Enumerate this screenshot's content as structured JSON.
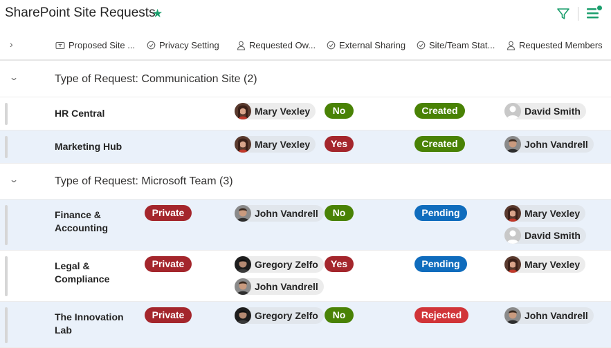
{
  "header": {
    "title": "SharePoint Site Requests"
  },
  "columns": [
    {
      "label": "Proposed Site ..."
    },
    {
      "label": "Privacy Setting"
    },
    {
      "label": "Requested Ow..."
    },
    {
      "label": "External Sharing"
    },
    {
      "label": "Site/Team Stat..."
    },
    {
      "label": "Requested Members"
    }
  ],
  "groups": [
    {
      "label": "Type of Request: Communication Site (2)"
    },
    {
      "label": "Type of Request: Microsoft Team (3)"
    }
  ],
  "rows": [
    {
      "title": "HR Central",
      "privacy": "",
      "owners": [
        "Mary Vexley"
      ],
      "external": "No",
      "status": "Created",
      "members": [
        "David Smith"
      ]
    },
    {
      "title": "Marketing Hub",
      "privacy": "",
      "owners": [
        "Mary Vexley"
      ],
      "external": "Yes",
      "status": "Created",
      "members": [
        "John Vandrell"
      ]
    },
    {
      "title": "Finance & Accounting",
      "privacy": "Private",
      "owners": [
        "John Vandrell"
      ],
      "external": "No",
      "status": "Pending",
      "members": [
        "Mary Vexley",
        "David Smith"
      ]
    },
    {
      "title": "Legal & Compliance",
      "privacy": "Private",
      "owners": [
        "Gregory Zelfo",
        "John Vandrell"
      ],
      "external": "Yes",
      "status": "Pending",
      "members": [
        "Mary Vexley"
      ]
    },
    {
      "title": "The Innovation Lab",
      "privacy": "Private",
      "owners": [
        "Gregory Zelfo"
      ],
      "external": "No",
      "status": "Rejected",
      "members": [
        "John Vandrell"
      ]
    }
  ],
  "colors": {
    "accent": "#1a9e6c",
    "pill_no": "#498205",
    "pill_yes": "#a4262c",
    "pill_pending": "#0f6cbd",
    "pill_rejected": "#d13438",
    "selected_row": "#eaf1fa"
  },
  "icons": {
    "favorite": "star-icon",
    "filter": "filter-icon",
    "view": "view-options-icon",
    "expand_all": "chevron-right-icon",
    "group_toggle": "chevron-down-icon",
    "col_text": "text-field-icon",
    "col_choice": "choice-circle-icon",
    "col_person": "person-icon"
  }
}
